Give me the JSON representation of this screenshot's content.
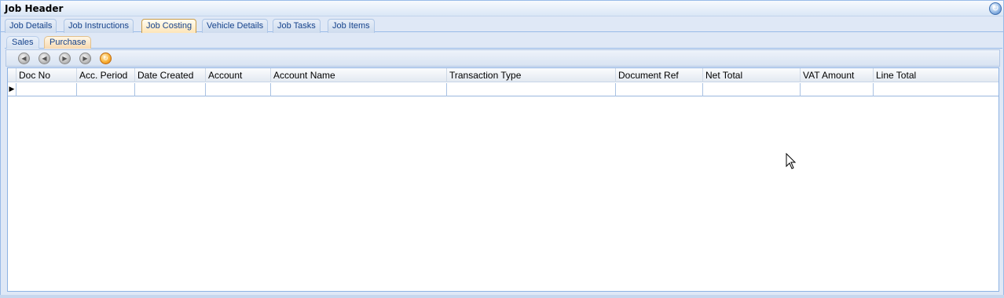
{
  "header": {
    "title": "Job Header",
    "refresh_icon": "refresh-icon"
  },
  "tabs": [
    {
      "label": "Job Details"
    },
    {
      "label": "Job Instructions"
    },
    {
      "label": "Job Costing"
    },
    {
      "label": "Vehicle Details"
    },
    {
      "label": "Job Tasks"
    },
    {
      "label": "Job Items"
    }
  ],
  "active_tab": "Job Costing",
  "subtabs": [
    {
      "label": "Sales"
    },
    {
      "label": "Purchase"
    }
  ],
  "active_subtab": "Purchase",
  "toolbar": {
    "buttons": [
      "first-icon",
      "previous-icon",
      "next-icon",
      "last-icon",
      "refresh-icon"
    ]
  },
  "grid": {
    "columns": [
      "Doc No",
      "Acc. Period",
      "Date Created",
      "Account",
      "Account Name",
      "Transaction Type",
      "Document Ref",
      "Net Total",
      "VAT Amount",
      "Line Total"
    ],
    "rows": [
      [
        "",
        "",
        "",
        "",
        "",
        "",
        "",
        "",
        "",
        ""
      ]
    ]
  },
  "colors": {
    "background": "#dfe8f6",
    "active_tab": "#fde5b8",
    "border": "#99bbe8"
  }
}
